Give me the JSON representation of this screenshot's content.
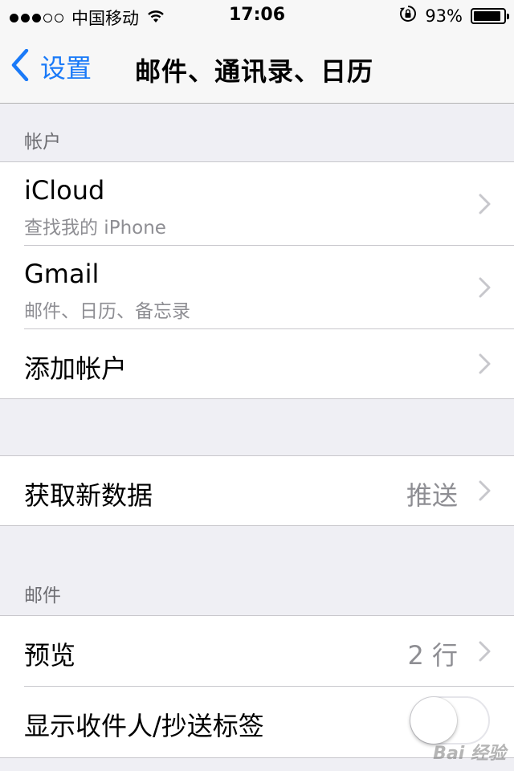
{
  "status_bar": {
    "signal_filled": 3,
    "signal_empty": 2,
    "carrier": "中国移动",
    "time": "17:06",
    "battery_percent": "93%",
    "battery_level": 0.93
  },
  "nav": {
    "back_label": "设置",
    "title": "邮件、通讯录、日历",
    "accent_color": "#1a7af8"
  },
  "accounts_section": {
    "header": "帐户",
    "items": [
      {
        "title": "iCloud",
        "subtitle": "查找我的 iPhone"
      },
      {
        "title": "Gmail",
        "subtitle": "邮件、日历、备忘录"
      },
      {
        "title": "添加帐户"
      }
    ]
  },
  "fetch_section": {
    "title": "获取新数据",
    "detail": "推送"
  },
  "mail_section": {
    "header": "邮件",
    "preview": {
      "title": "预览",
      "detail": "2 行"
    },
    "show_to_cc": {
      "title": "显示收件人/抄送标签",
      "enabled": false
    }
  },
  "watermark": "Bai 经验"
}
